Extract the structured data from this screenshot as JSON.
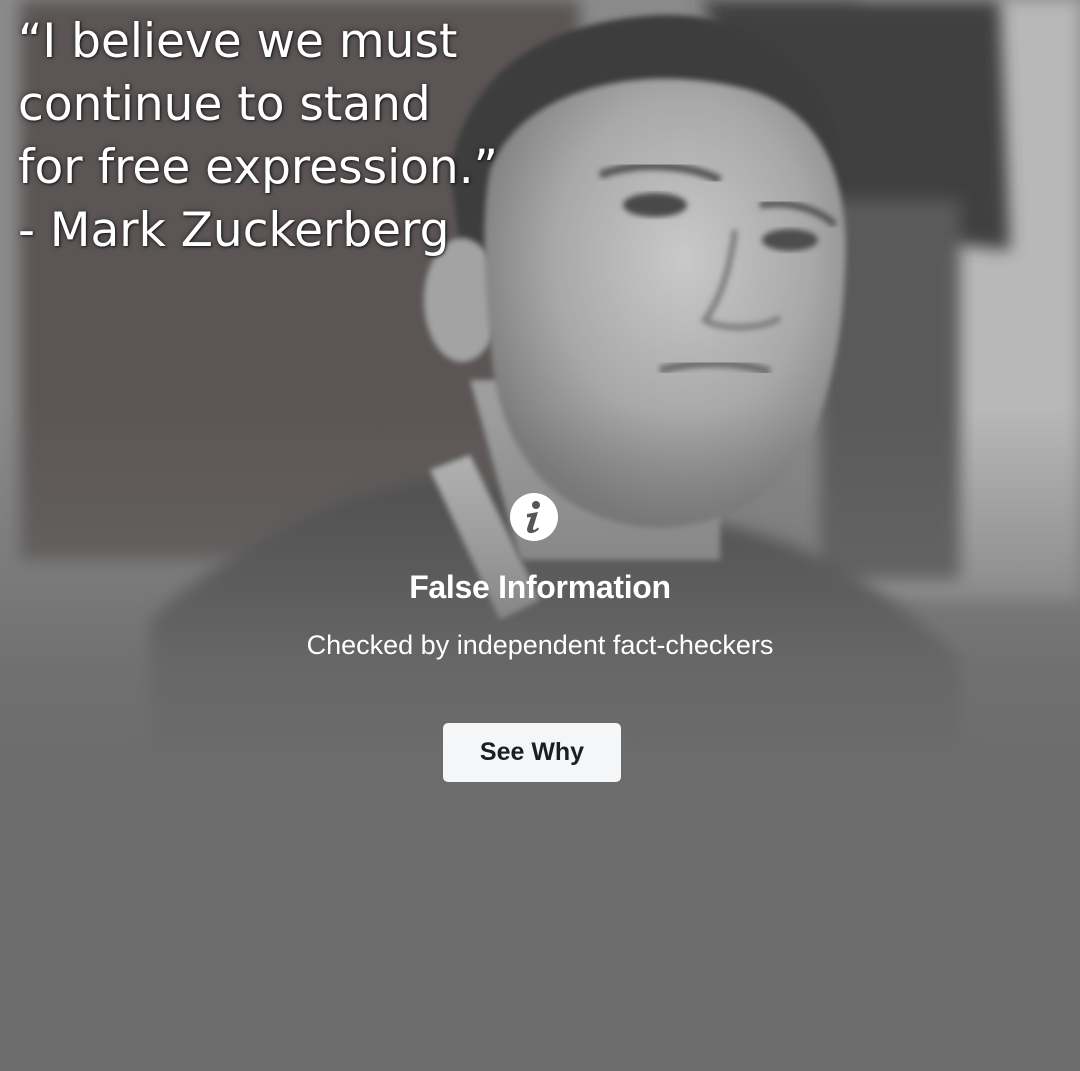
{
  "quote": {
    "lines": [
      "“I believe we must",
      "continue to stand",
      "for free expression.”",
      "- Mark Zuckerberg"
    ]
  },
  "fact_check_overlay": {
    "icon": "info-icon",
    "title": "False Information",
    "subtitle": "Checked by independent fact-checkers",
    "button_label": "See Why"
  },
  "colors": {
    "overlay_gray": "#6c6c6c",
    "button_bg": "#f5f6f7",
    "button_text": "#1c1e21",
    "text": "#ffffff"
  }
}
